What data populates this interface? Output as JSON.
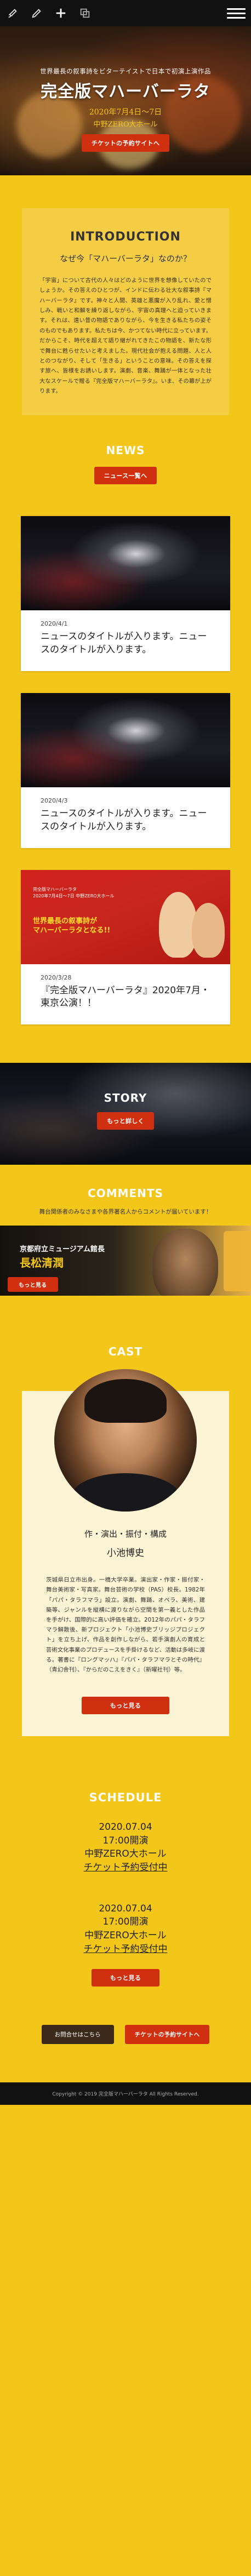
{
  "toolbar": {
    "icons": [
      "brush-icon",
      "pen-icon",
      "plus-icon",
      "crop-icon",
      "menu-icon"
    ]
  },
  "hero": {
    "subtitle": "世界最長の叙事詩をビターテイストで日本で初演上演作品",
    "title": "完全版マハーバーラタ",
    "date": "2020年7月4日～7日",
    "venue": "中野ZERO大ホール",
    "ticket_label": "チケットの予約サイトへ"
  },
  "intro": {
    "heading": "INTRODUCTION",
    "question": "なぜ今「マハーバーラタ」なのか？",
    "body": "「宇宙」について古代の人々はどのように世界を想像していたのでしょうか。その答えのひとつが、インドに伝わる壮大な叙事詩『マハーバーラタ』です。神々と人間、英雄と悪魔が入り乱れ、愛と憎しみ、戦いと和解を繰り返しながら、宇宙の真理へと迫っていきます。それは、遠い昔の物語でありながら、今を生きる私たちの姿そのものでもあります。私たちは今、かつてない時代に立っています。だからこそ、時代を超えて語り継がれてきたこの物語を、新たな形で舞台に甦らせたいと考えました。現代社会が抱える問題、人と人とのつながり、そして「生きる」ということの意味。その答えを探す旅へ、皆様をお誘いします。演劇、音楽、舞踊が一体となった壮大なスケールで贈る『完全版マハーバーラタ』。いま、その幕が上がります。"
  },
  "news": {
    "heading": "NEWS",
    "button_label": "ニュース一覧へ",
    "items": [
      {
        "date": "2020/4/1",
        "title": "ニュースのタイトルが入ります。ニュースのタイトルが入ります。"
      },
      {
        "date": "2020/4/3",
        "title": "ニュースのタイトルが入ります。ニュースのタイトルが入ります。"
      },
      {
        "date": "2020/3/28",
        "title": "『完全版マハーバーラタ』2020年7月・東京公演！！"
      }
    ],
    "poster_top": "完全版マハーバーラタ\n2020年7月4日〜7日 中野ZERO大ホール",
    "poster_headline": "世界最長の叙事詩が\nマハーバーラタとなる!!"
  },
  "story": {
    "heading": "STORY",
    "button_label": "もっと詳しく"
  },
  "comments": {
    "heading": "COMMENTS",
    "lead": "舞台関係者のみなさまや各界著名人からコメントが届いています！",
    "banner_role": "京都府立ミュージアム館長",
    "banner_name": "長松清潤",
    "button_label": "もっと見る"
  },
  "cast": {
    "heading": "CAST",
    "role": "作・演出・振付・構成",
    "name": "小池博史",
    "bio": "茨城県日立市出身。一橋大学卒業。演出家・作家・振付家・舞台美術家・写真家。舞台芸術の学校（PAS）校長。1982年「パパ・タラフマラ」設立。演劇、舞踊、オペラ、美術、建築等、ジャンルを縦横に渡りながら空間を第一義とした作品を手がけ、国際的に高い評価を確立。2012年のパパ・タラフマラ解散後、新プロジェクト「小池博史ブリッジプロジェクト」を立ち上げ、作品を創作しながら、若手演劇人の育成と芸術文化事業のプロデュースを手掛けるなど、活動は多岐に渡る。著書に『ロングマッハ』『パパ・タラフマラとその時代』（青幻舎刊）、『からだのこえをきく』（新曜社刊）等。",
    "button_label": "もっと見る"
  },
  "schedule": {
    "heading": "SCHEDULE",
    "items": [
      {
        "date": "2020.07.04",
        "time": "17:00開演",
        "venue": "中野ZERO大ホール",
        "link": "チケット予約受付中"
      },
      {
        "date": "2020.07.04",
        "time": "17:00開演",
        "venue": "中野ZERO大ホール",
        "link": "チケット予約受付中"
      }
    ],
    "button_label": "もっと見る"
  },
  "bottom": {
    "contact_label": "お問合せはこちら",
    "ticket_label": "チケットの予約サイトへ"
  },
  "footer": {
    "copyright": "Copyright © 2019 完全版マハーバーラタ All Rights Reserved."
  }
}
